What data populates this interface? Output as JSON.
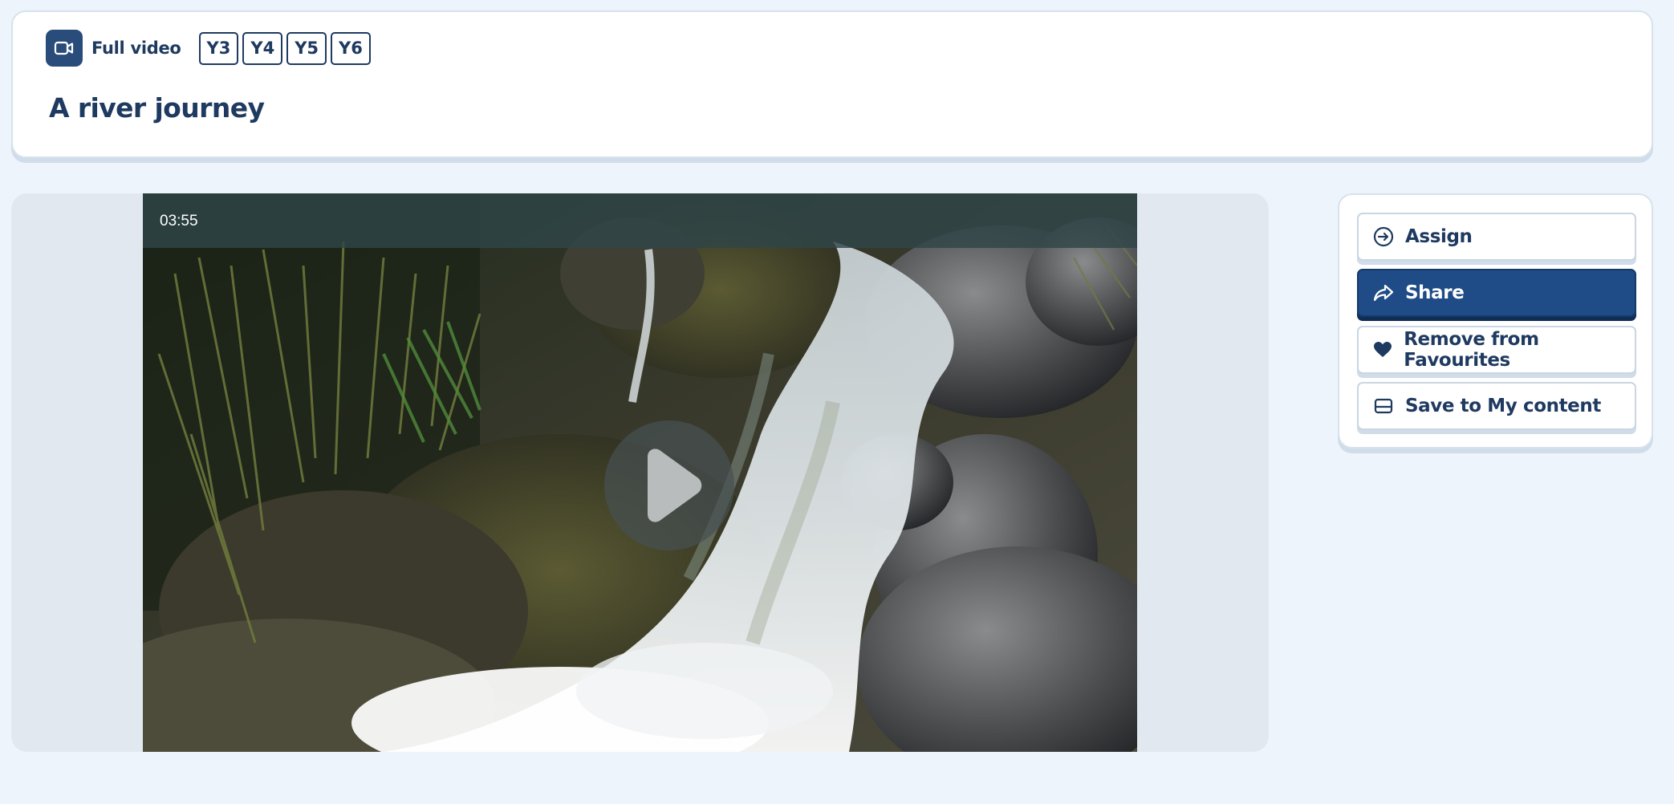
{
  "header": {
    "content_type": "Full video",
    "content_type_icon": "video-camera-icon",
    "year_tags": [
      "Y3",
      "Y4",
      "Y5",
      "Y6"
    ],
    "title": "A river journey"
  },
  "player": {
    "duration": "03:55",
    "play_icon": "play-icon"
  },
  "actions": [
    {
      "label": "Assign",
      "icon": "arrow-circle-right-icon"
    },
    {
      "label": "Share",
      "icon": "share-arrow-icon",
      "primary": true
    },
    {
      "label": "Remove from Favourites",
      "icon": "heart-icon"
    },
    {
      "label": "Save to My content",
      "icon": "save-tray-icon"
    }
  ],
  "colors": {
    "background": "#edf4fb",
    "primary": "#1f4b86",
    "text": "#1f3a60"
  }
}
